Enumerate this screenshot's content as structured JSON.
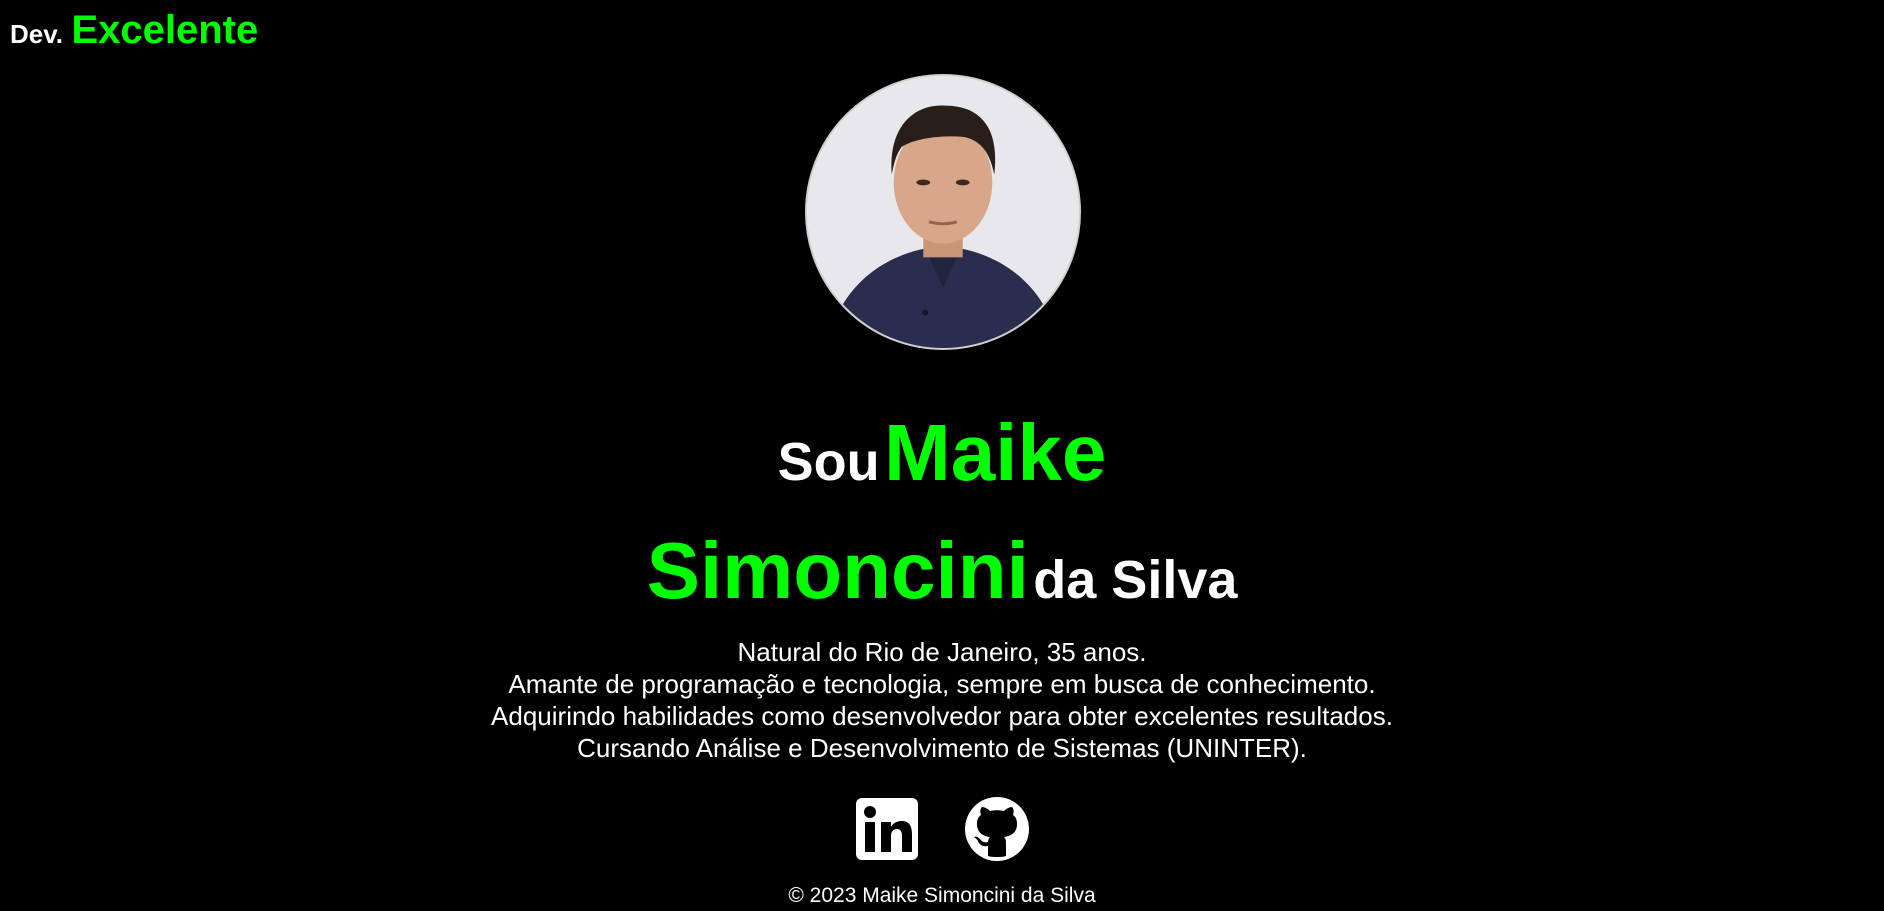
{
  "header": {
    "brand_prefix": "Dev.",
    "brand_accent": "Excelente"
  },
  "profile": {
    "avatar_icon": "profile-photo"
  },
  "hero": {
    "word_sou": "Sou",
    "word_maike": "Maike",
    "word_simoncini": "Simoncini",
    "word_da_silva": "da Silva"
  },
  "bio": {
    "lines": [
      "Natural do Rio de Janeiro, 35 anos.",
      "Amante de programação e tecnologia, sempre em busca de conhecimento.",
      "Adquirindo habilidades como desenvolvedor para obter excelentes resultados.",
      "Cursando Análise e Desenvolvimento de Sistemas (UNINTER)."
    ]
  },
  "socials": [
    {
      "icon": "linkedin-icon"
    },
    {
      "icon": "github-icon"
    }
  ],
  "footer": {
    "copyright": "© 2023 Maike Simoncini da Silva"
  },
  "colors": {
    "background": "#000000",
    "accent": "#00ff00",
    "text": "#ffffff"
  }
}
